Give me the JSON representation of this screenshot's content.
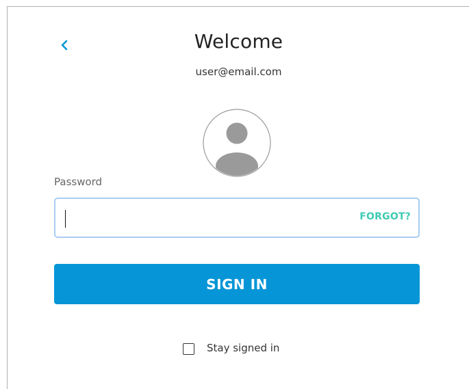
{
  "header": {
    "back_icon": "chevron-left-icon",
    "title": "Welcome",
    "email": "user@email.com"
  },
  "avatar": {
    "icon": "user-avatar-icon"
  },
  "password": {
    "label": "Password",
    "value": "",
    "forgot_label": "FORGOT?"
  },
  "actions": {
    "sign_in_label": "SIGN IN"
  },
  "stay_signed_in": {
    "label": "Stay signed in",
    "checked": false
  },
  "colors": {
    "accent": "#0696d7",
    "forgot": "#3ecbb4",
    "field_border": "#a9cdf2"
  }
}
